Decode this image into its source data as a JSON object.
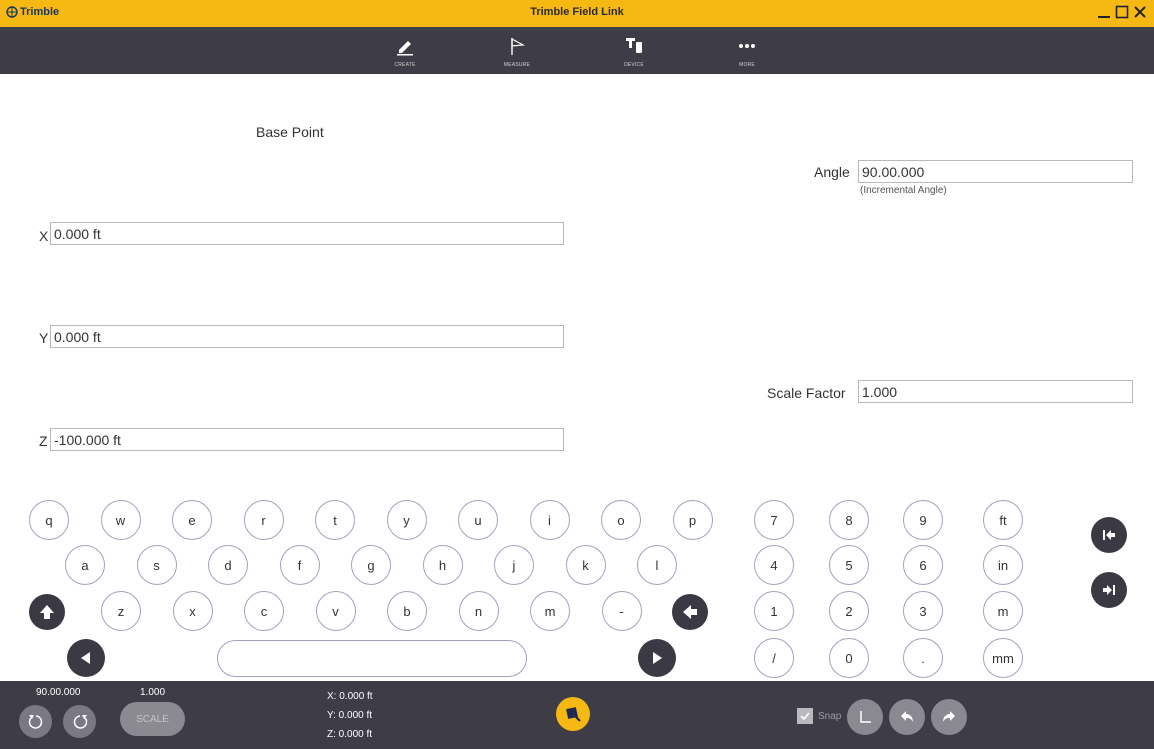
{
  "titlebar": {
    "logo_text": "Trimble",
    "title": "Trimble Field Link"
  },
  "toolbar": {
    "items": [
      {
        "label": "CREATE",
        "icon": "pencil-icon"
      },
      {
        "label": "MEASURE",
        "icon": "flag-icon"
      },
      {
        "label": "DEVICE",
        "icon": "device-icon"
      },
      {
        "label": "MORE",
        "icon": "more-dots-icon"
      }
    ]
  },
  "form": {
    "base_point_label": "Base Point",
    "x_label": "X",
    "x_value": "0.000 ft",
    "y_label": "Y",
    "y_value": "0.000 ft",
    "z_label": "Z",
    "z_value": "-100.000 ft",
    "angle_label": "Angle",
    "angle_value": "90.00.000",
    "angle_hint": "(Incremental Angle)",
    "scale_label": "Scale Factor",
    "scale_value": "1.000"
  },
  "keyboard": {
    "row1": [
      "q",
      "w",
      "e",
      "r",
      "t",
      "y",
      "u",
      "i",
      "o",
      "p"
    ],
    "row2": [
      "a",
      "s",
      "d",
      "f",
      "g",
      "h",
      "j",
      "k",
      "l"
    ],
    "row3": [
      "z",
      "x",
      "c",
      "v",
      "b",
      "n",
      "m",
      "-"
    ],
    "numpad": [
      [
        "7",
        "8",
        "9",
        "ft"
      ],
      [
        "4",
        "5",
        "6",
        "in"
      ],
      [
        "1",
        "2",
        "3",
        "m"
      ],
      [
        "/",
        "0",
        ".",
        "mm"
      ]
    ]
  },
  "statusbar": {
    "angle": "90.00.000",
    "scale": "1.000",
    "scale_button": "SCALE",
    "x": "X: 0.000 ft",
    "y": "Y: 0.000 ft",
    "z": "Z: 0.000 ft",
    "snap_label": "Snap"
  },
  "colors": {
    "accent": "#f6b913",
    "dark": "#3e3d47"
  }
}
